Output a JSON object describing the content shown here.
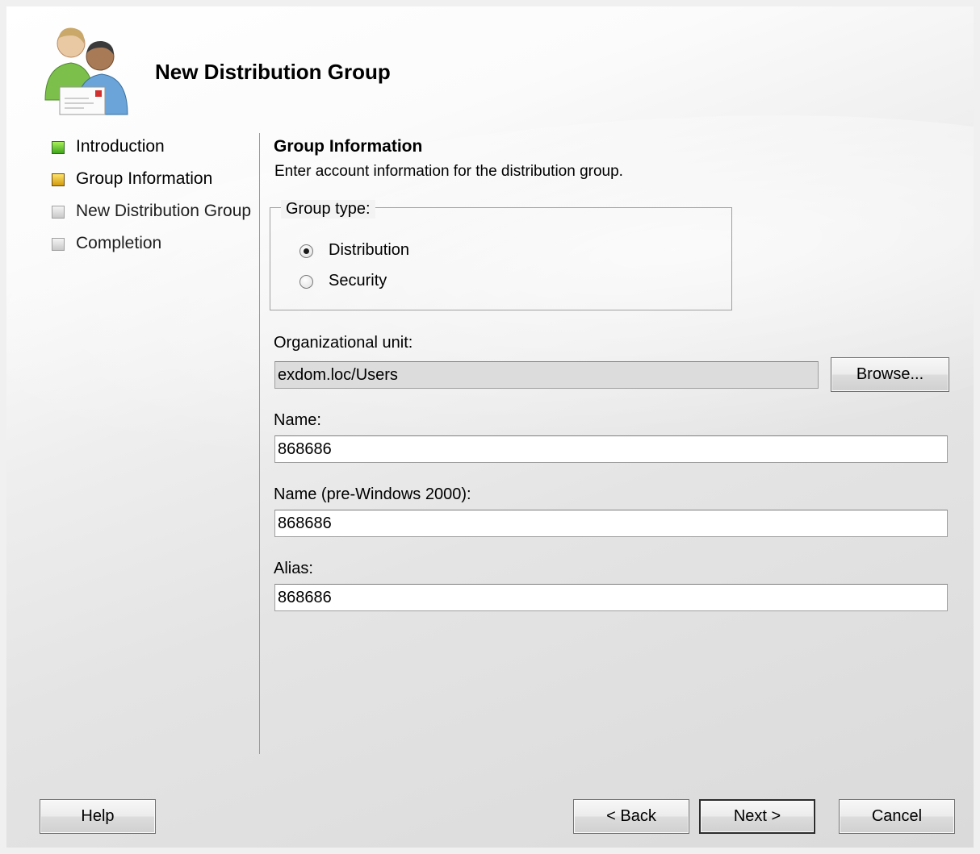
{
  "window": {
    "title": "New Distribution Group"
  },
  "steps": [
    {
      "label": "Introduction",
      "state": "done"
    },
    {
      "label": "Group Information",
      "state": "current"
    },
    {
      "label": "New Distribution Group",
      "state": "pending"
    },
    {
      "label": "Completion",
      "state": "pending"
    }
  ],
  "section": {
    "title": "Group Information",
    "description": "Enter account information for the distribution group."
  },
  "group_type": {
    "legend": "Group type:",
    "options": [
      {
        "label": "Distribution",
        "checked": true
      },
      {
        "label": "Security",
        "checked": false
      }
    ]
  },
  "fields": {
    "ou": {
      "label": "Organizational unit:",
      "value": "exdom.loc/Users",
      "browse_label": "Browse..."
    },
    "name": {
      "label": "Name:",
      "value": "868686"
    },
    "pre2000": {
      "label": "Name (pre-Windows 2000):",
      "value": "868686"
    },
    "alias": {
      "label": "Alias:",
      "value": "868686"
    }
  },
  "buttons": {
    "help": "Help",
    "back": "< Back",
    "next": "Next >",
    "cancel": "Cancel"
  },
  "icons": {
    "header": "users-mail-icon"
  }
}
